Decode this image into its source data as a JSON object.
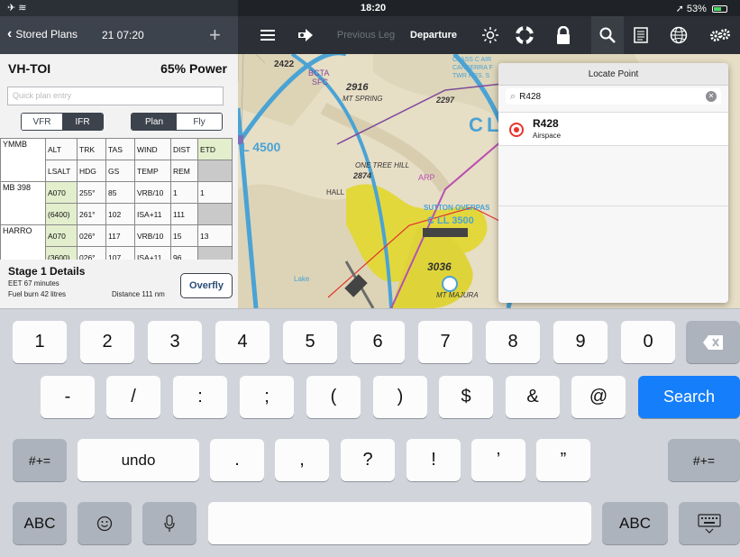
{
  "status_bar": {
    "left": "✈ ≋",
    "time": "18:20",
    "right": "➚ 53%"
  },
  "left_header": {
    "back_label": "Stored Plans",
    "time": "21 07:20",
    "add_icon": "plus-icon"
  },
  "map_toolbar": {
    "list_icon": "list-icon",
    "route_icon": "route-icon",
    "previous_leg": "Previous Leg",
    "departure": "Departure",
    "brightness_icon": "brightness-icon",
    "help_icon": "lifebuoy-icon",
    "lock_icon": "lock-icon",
    "search_icon": "search-icon",
    "notes_icon": "document-icon",
    "globe_icon": "globe-icon",
    "settings_icon": "settings-icon"
  },
  "flight_plan": {
    "registration": "VH-TOI",
    "power": "65% Power",
    "quick_entry_placeholder": "Quick plan entry",
    "mode_buttons": [
      "VFR",
      "IFR"
    ],
    "mode_selected": "IFR",
    "view_buttons": [
      "Plan",
      "Fly"
    ],
    "view_selected": "Plan",
    "origin": "YMMB",
    "headers_row1": [
      "ALT",
      "TRK",
      "TAS",
      "WIND",
      "DIST",
      "ETD"
    ],
    "headers_row2": [
      "LSALT",
      "HDG",
      "GS",
      "TEMP",
      "REM",
      ""
    ],
    "legs": [
      {
        "waypoint": "MB",
        "waypoint_sub": "398",
        "row1": [
          "A070",
          "255°",
          "85",
          "VRB/10",
          "1",
          "1"
        ],
        "row2": [
          "(6400)",
          "261°",
          "102",
          "ISA+11",
          "111",
          ""
        ]
      },
      {
        "waypoint": "HARRO",
        "waypoint_sub": "",
        "row1": [
          "A070",
          "026°",
          "117",
          "VRB/10",
          "15",
          "13"
        ],
        "row2": [
          "(3600)",
          "026°",
          "107",
          "ISA+11",
          "96",
          ""
        ]
      }
    ],
    "stage": {
      "title": "Stage 1 Details",
      "eet": "EET 67 minutes",
      "fuel": "Fuel burn 42 litres",
      "distance": "Distance 111 nm",
      "overfly_label": "Overfly"
    }
  },
  "map": {
    "labels": {
      "bcta": "BCTA",
      "sfc": "SFC",
      "alt_2916": "2916",
      "mt_spring": "MT SPRING",
      "alt_2297": "2297",
      "alt_2422": "2422",
      "class_c": "CLASS C AIR",
      "canberra": "CANBERRA F",
      "twr": "TWR HRS. S",
      "l4500": "L 4500",
      "one_tree_hill": "ONE TREE HILL",
      "alt_2874": "2874",
      "sutton": "SUTTON OVERPAS",
      "cl3500": "C LL 3500",
      "hall": "HALL",
      "lake": "Lake",
      "alt_3036": "3036",
      "majura": "MT MAJURA",
      "arp": "ARP",
      "c": "C",
      "l": "L"
    }
  },
  "locate_point": {
    "title": "Locate Point",
    "search_value": "R428",
    "results": [
      {
        "name": "R428",
        "type": "Airspace"
      }
    ]
  },
  "keyboard": {
    "row1": [
      "1",
      "2",
      "3",
      "4",
      "5",
      "6",
      "7",
      "8",
      "9",
      "0"
    ],
    "row2": [
      "-",
      "/",
      ":",
      ";",
      "(",
      ")",
      "$",
      "&",
      "@"
    ],
    "search_label": "Search",
    "row3": [
      ".",
      ",",
      "?",
      "!",
      "’",
      "”"
    ],
    "symbols_label": "#+=",
    "undo_label": "undo",
    "abc_label": "ABC"
  }
}
